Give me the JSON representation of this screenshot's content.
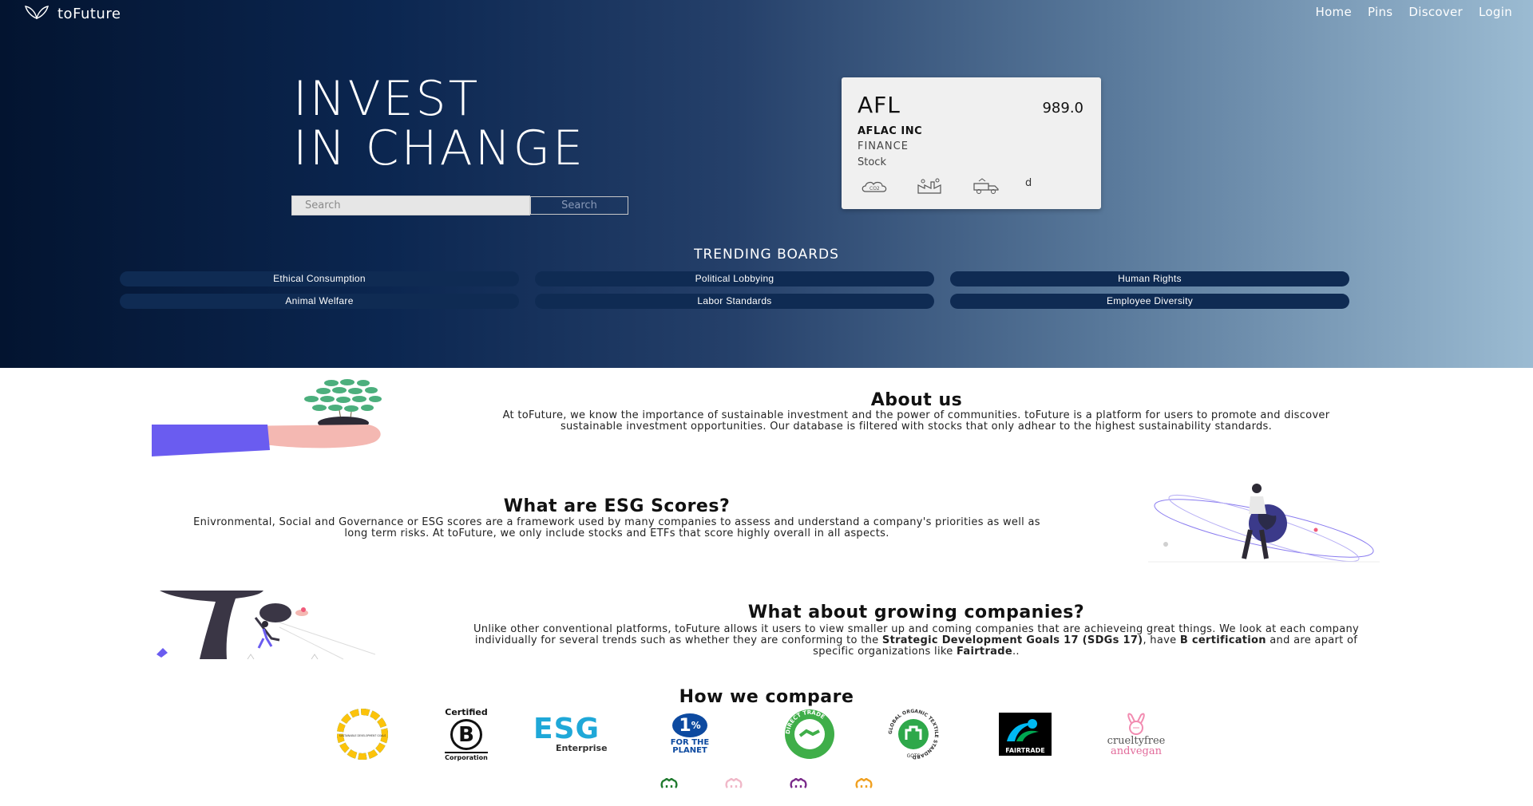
{
  "header": {
    "brand": "toFuture",
    "nav": [
      "Home",
      "Pins",
      "Discover",
      "Login"
    ]
  },
  "hero": {
    "headline_line1": "INVEST",
    "headline_line2": "IN CHANGE",
    "search_placeholder": "Search",
    "search_button": "Search"
  },
  "stock_card": {
    "ticker": "AFL",
    "price": "989.0",
    "company": "AFLAC INC",
    "sector": "FINANCE",
    "type": "Stock",
    "icons": [
      "co2-cloud-icon",
      "factory-icon",
      "recycle-truck-icon"
    ],
    "extra": "d"
  },
  "trending": {
    "title": "TRENDING BOARDS",
    "boards": [
      "Ethical Consumption",
      "Political Lobbying",
      "Human Rights",
      "Animal Welfare",
      "Labor Standards",
      "Employee Diversity"
    ]
  },
  "about": {
    "title": "About us",
    "text": "At toFuture, we know the importance of sustainable investment and the power of communities. toFuture is a platform for users to promote and discover sustainable investment opportunities. Our database is filtered with stocks that only adhear to the highest sustainability standards."
  },
  "esg": {
    "title": "What are ESG Scores?",
    "text": "Enivronmental, Social and Governance or ESG scores are a framework used by many companies to assess and understand a company's priorities as well as long term risks. At toFuture, we only include stocks and ETFs that score highly overall in all aspects."
  },
  "growing": {
    "title": "What about growing companies?",
    "text_1": "Unlike other conventional platforms, toFuture allows it users to view smaller up and coming companies that are achieveing great things. We look at each company individually for several trends such as whether they are conforming to the ",
    "bold_1": "Strategic Development Goals 17 (SDGs 17)",
    "text_2": ", have ",
    "bold_2": "B certification",
    "text_3": " and are apart of specific organizations like ",
    "bold_3": "Fairtrade",
    "text_4": ".."
  },
  "compare": {
    "title": "How we compare",
    "logos": {
      "sdg": "SUSTAINABLE DEVELOPMENT GOALS",
      "bcorp_top": "Certified",
      "bcorp_letter": "B",
      "bcorp_bottom": "Corporation",
      "esg_main": "ESG",
      "esg_sub": "Enterprise",
      "onepct_num": "1",
      "onepct_pct": "%",
      "onepct_for": "FOR THE",
      "onepct_planet": "PLANET",
      "directtrade": "DIRECT TRADE",
      "gots": "GLOBAL ORGANIC TEXTILE STANDARD",
      "gots_short": "GOTS",
      "fairtrade": "FAIRTRADE",
      "cruelty_1": "crueltyfree",
      "cruelty_2": "andvegan"
    }
  },
  "footer": {
    "icons": [
      "github-icon-green",
      "github-icon-pink",
      "github-icon-purple",
      "github-icon-orange"
    ],
    "colors": [
      "#1f7a2e",
      "#f0b8c8",
      "#7a2a8a",
      "#f0a020"
    ]
  }
}
